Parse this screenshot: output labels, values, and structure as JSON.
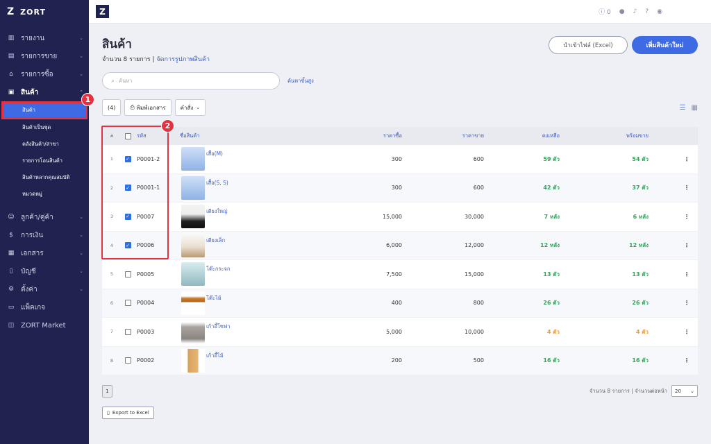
{
  "app": {
    "name": "ZORT",
    "logo_letter": "Z"
  },
  "sidebar": {
    "items": [
      {
        "label": "รายงาน",
        "icon": "chart-icon"
      },
      {
        "label": "รายการขาย",
        "icon": "clipboard-icon"
      },
      {
        "label": "รายการซื้อ",
        "icon": "basket-icon"
      },
      {
        "label": "สินค้า",
        "icon": "box-icon"
      },
      {
        "label": "ลูกค้า/คู่ค้า",
        "icon": "users-icon"
      },
      {
        "label": "การเงิน",
        "icon": "money-icon"
      },
      {
        "label": "เอกสาร",
        "icon": "document-icon"
      },
      {
        "label": "บัญชี",
        "icon": "ledger-icon"
      },
      {
        "label": "ตั้งค่า",
        "icon": "gear-icon"
      },
      {
        "label": "แพ็คเกจ",
        "icon": "package-icon"
      },
      {
        "label": "ZORT Market",
        "icon": "market-icon"
      }
    ],
    "sub_items": [
      "สินค้า",
      "สินค้าเป็นชุด",
      "คลังสินค้า/สาขา",
      "รายการโอนสินค้า",
      "สินค้าหลากคุณสมบัติ",
      "หมวดหมู่"
    ]
  },
  "topbar": {
    "coin_count": "0"
  },
  "page": {
    "title": "สินค้า",
    "count_text": "จำนวน 8 รายการ",
    "separator": " | ",
    "manage_link": "จัดการรูปภาพสินค้า",
    "import_button": "นำเข้าไฟล์ (Excel)",
    "add_button": "เพิ่มสินค้าใหม่",
    "search_placeholder": "ค้นหา",
    "advanced_search": "ค้นหาขั้นสูง",
    "selected_count": "(4)",
    "print_button": "พิมพ์เอกสาร",
    "command_button": "คำสั่ง"
  },
  "table": {
    "headers": {
      "num": "#",
      "code": "รหัส",
      "name": "ชื่อสินค้า",
      "cost": "ราคาซื้อ",
      "price": "ราคาขาย",
      "remaining": "คงเหลือ",
      "ready": "พร้อมขาย"
    },
    "rows": [
      {
        "num": "1",
        "checked": true,
        "code": "P0001-2",
        "name": "เสื้อ(M)",
        "cost": "300",
        "price": "600",
        "remaining": "59 ตัว",
        "ready": "54 ตัว",
        "thumb": "shirt",
        "status": "green"
      },
      {
        "num": "2",
        "checked": true,
        "code": "P0001-1",
        "name": "เสื้อ(S, S)",
        "cost": "300",
        "price": "600",
        "remaining": "42 ตัว",
        "ready": "37 ตัว",
        "thumb": "shirt",
        "status": "green"
      },
      {
        "num": "3",
        "checked": true,
        "code": "P0007",
        "name": "เตียงใหญ่",
        "cost": "15,000",
        "price": "30,000",
        "remaining": "7 หลัง",
        "ready": "6 หลัง",
        "thumb": "bed",
        "status": "green"
      },
      {
        "num": "4",
        "checked": true,
        "code": "P0006",
        "name": "เตียงเล็ก",
        "cost": "6,000",
        "price": "12,000",
        "remaining": "12 หลัง",
        "ready": "12 หลัง",
        "thumb": "bed2",
        "status": "green"
      },
      {
        "num": "5",
        "checked": false,
        "code": "P0005",
        "name": "โต๊ะกระจก",
        "cost": "7,500",
        "price": "15,000",
        "remaining": "13 ตัว",
        "ready": "13 ตัว",
        "thumb": "glass",
        "status": "green"
      },
      {
        "num": "6",
        "checked": false,
        "code": "P0004",
        "name": "โต๊ะไม้",
        "cost": "400",
        "price": "800",
        "remaining": "26 ตัว",
        "ready": "26 ตัว",
        "thumb": "table",
        "status": "green"
      },
      {
        "num": "7",
        "checked": false,
        "code": "P0003",
        "name": "เก้าอี้โซฟา",
        "cost": "5,000",
        "price": "10,000",
        "remaining": "4 ตัว",
        "ready": "4 ตัว",
        "thumb": "sofa",
        "status": "orange"
      },
      {
        "num": "8",
        "checked": false,
        "code": "P0002",
        "name": "เก้าอี้ไม้",
        "cost": "200",
        "price": "500",
        "remaining": "16 ตัว",
        "ready": "16 ตัว",
        "thumb": "chair",
        "status": "green"
      }
    ]
  },
  "footer": {
    "page": "1",
    "info": "จำนวน 8 รายการ | จำนวนต่อหน้า",
    "per_page": "20",
    "export": "Export to Excel"
  },
  "annotations": {
    "badge1": "1",
    "badge2": "2"
  },
  "colors": {
    "sidebar": "#20234f",
    "accent": "#3e6be3",
    "highlight": "#e53241",
    "stock_ok": "#2ea55a",
    "stock_low": "#f39a2a"
  }
}
